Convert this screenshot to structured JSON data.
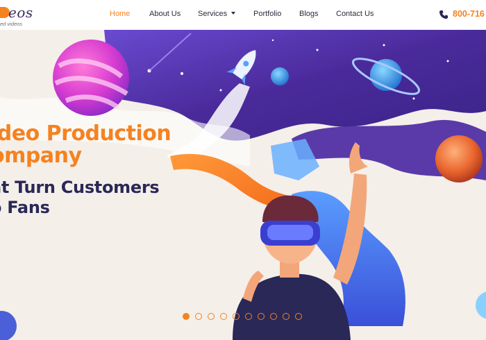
{
  "header": {
    "logo": {
      "wordmark": "eos",
      "tagline": "ed videos"
    },
    "nav": [
      {
        "label": "Home",
        "active": true
      },
      {
        "label": "About Us",
        "active": false
      },
      {
        "label": "Services",
        "active": false,
        "has_dropdown": true
      },
      {
        "label": "Portfolio",
        "active": false
      },
      {
        "label": "Blogs",
        "active": false
      },
      {
        "label": "Contact Us",
        "active": false
      }
    ],
    "phone": {
      "icon": "phone-icon",
      "number": "800-716"
    }
  },
  "hero": {
    "headline_line1": "ideo Production",
    "headline_line2": "ompany",
    "subline1": "at Turn Customers",
    "subline2": "o Fans"
  },
  "carousel": {
    "slide_count": 10,
    "active_index": 0
  },
  "colors": {
    "accent": "#f58220",
    "navy": "#2a2857",
    "purple": "#5a3aa8",
    "background": "#f4efe9"
  }
}
